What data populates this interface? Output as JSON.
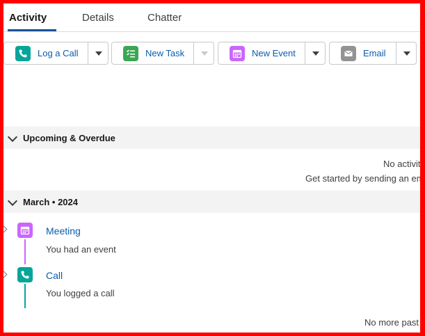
{
  "tabs": [
    {
      "label": "Activity",
      "active": true
    },
    {
      "label": "Details",
      "active": false
    },
    {
      "label": "Chatter",
      "active": false
    }
  ],
  "actions": {
    "log_call": {
      "label": "Log a Call",
      "icon": "phone-icon",
      "color": "#06a59a"
    },
    "new_task": {
      "label": "New Task",
      "icon": "task-list-icon",
      "color": "#3ba755"
    },
    "new_event": {
      "label": "New Event",
      "icon": "calendar-icon",
      "color": "#cb65ff"
    },
    "email": {
      "label": "Email",
      "icon": "email-icon",
      "color": "#939393"
    }
  },
  "sections": {
    "upcoming": {
      "title": "Upcoming & Overdue",
      "empty_line1": "No activiti",
      "empty_line2": "Get started by sending an ema"
    },
    "month": {
      "title": "March • 2024",
      "items": [
        {
          "title": "Meeting",
          "description": "You had an event",
          "icon": "calendar-icon",
          "color": "#cb65ff"
        },
        {
          "title": "Call",
          "description": "You logged a call",
          "icon": "phone-icon",
          "color": "#06a59a"
        }
      ]
    },
    "footer": "No more past a"
  }
}
